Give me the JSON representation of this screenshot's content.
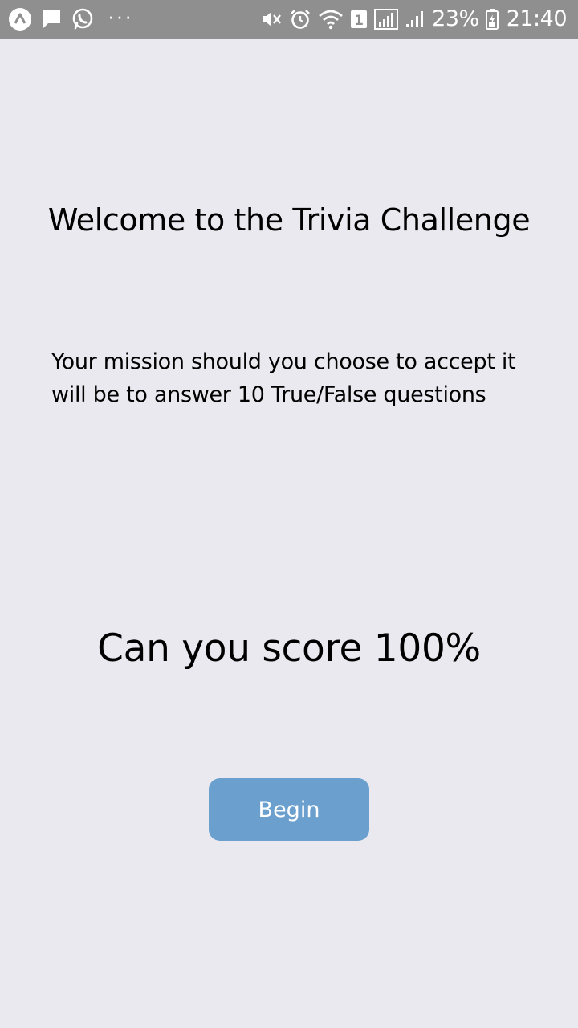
{
  "status_bar": {
    "battery_percent": "23%",
    "time": "21:40",
    "sim_badge": "1",
    "overflow_dots": "···",
    "background_color": "#8f8f8f"
  },
  "main": {
    "title": "Welcome to the Trivia Challenge",
    "mission_line1": "Your mission should you choose to accept it",
    "mission_line2": "will be to answer 10 True/False questions",
    "challenge": "Can you score 100%",
    "begin_label": "Begin",
    "button_color": "#6a9fce",
    "background_color": "#e9e9ef"
  }
}
